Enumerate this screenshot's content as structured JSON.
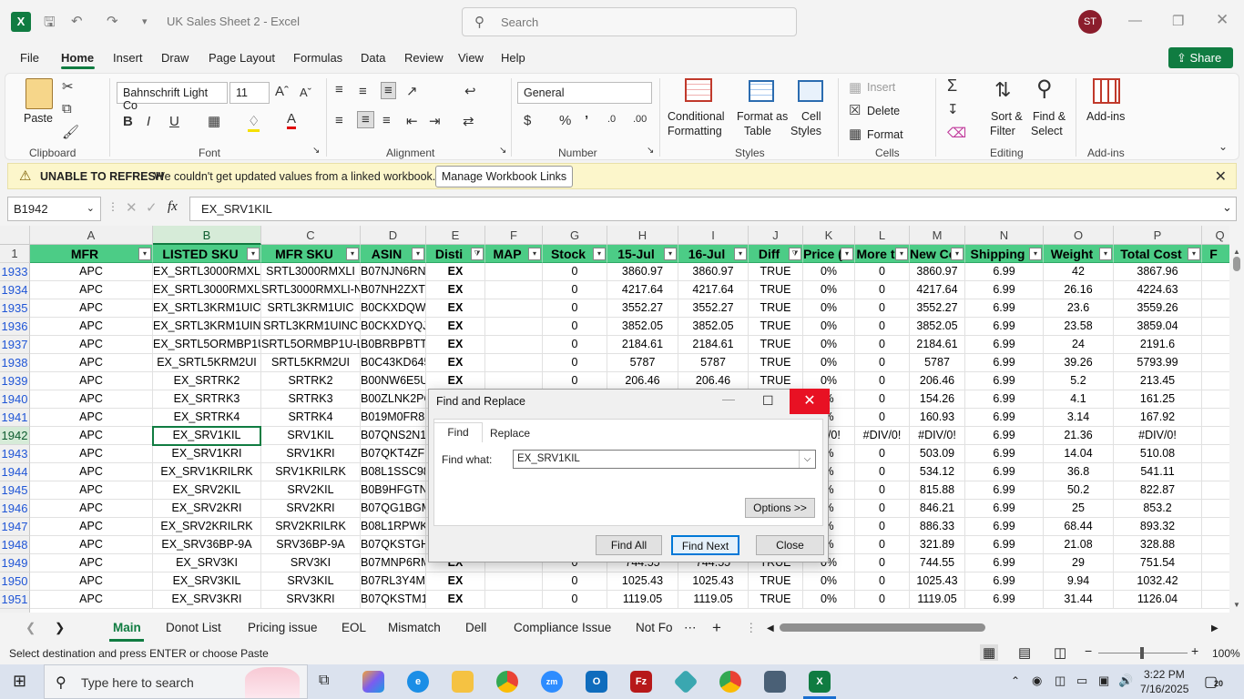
{
  "app": {
    "title": "UK Sales Sheet 2  -  Excel",
    "search_placeholder": "Search",
    "user_initials": "ST"
  },
  "menu": {
    "tabs": [
      "File",
      "Home",
      "Insert",
      "Draw",
      "Page Layout",
      "Formulas",
      "Data",
      "Review",
      "View",
      "Help"
    ],
    "active": "Home",
    "share_label": "Share"
  },
  "ribbon": {
    "clipboard": {
      "paste": "Paste",
      "label": "Clipboard"
    },
    "font": {
      "name": "Bahnschrift Light Co",
      "size": "11",
      "label": "Font"
    },
    "alignment": {
      "label": "Alignment"
    },
    "number": {
      "format": "General",
      "label": "Number"
    },
    "styles": {
      "conditional": "Conditional",
      "conditional2": "Formatting",
      "format_as": "Format as",
      "format_as2": "Table",
      "cell": "Cell",
      "cell2": "Styles",
      "label": "Styles"
    },
    "cells": {
      "insert": "Insert",
      "delete": "Delete",
      "format": "Format",
      "label": "Cells"
    },
    "editing": {
      "sort": "Sort &",
      "sort2": "Filter",
      "find": "Find &",
      "find2": "Select",
      "label": "Editing"
    },
    "addins": {
      "btn": "Add-ins",
      "label": "Add-ins"
    }
  },
  "warning": {
    "title": "UNABLE TO REFRESH",
    "message": "We couldn't get updated values from a linked workbook.",
    "button": "Manage Workbook Links"
  },
  "formula_bar": {
    "name_box": "B1942",
    "fx": "fx",
    "content": "EX_SRV1KIL"
  },
  "sheet": {
    "col_letters": [
      "A",
      "B",
      "C",
      "D",
      "E",
      "F",
      "G",
      "H",
      "I",
      "J",
      "K",
      "L",
      "M",
      "N",
      "O",
      "P",
      "Q"
    ],
    "header_row_number": "1",
    "headers": [
      "MFR",
      "LISTED SKU",
      "MFR SKU",
      "ASIN",
      "Disti",
      "MAP",
      "Stock",
      "15-Jul",
      "16-Jul",
      "Diff",
      "Price (",
      "More t",
      "New Co",
      "Shipping",
      "Weight",
      "Total Cost",
      "F"
    ],
    "rows": [
      {
        "n": "1933",
        "c": [
          "APC",
          "EX_SRTL3000RMXLI",
          "SRTL3000RMXLI",
          "B07NJN6RNX",
          "EX",
          "",
          "0",
          "3860.97",
          "3860.97",
          "TRUE",
          "0%",
          "0",
          "3860.97",
          "6.99",
          "42",
          "3867.96"
        ]
      },
      {
        "n": "1934",
        "c": [
          "APC",
          "EX_SRTL3000RMXLI-NC",
          "SRTL3000RMXLI-NC",
          "B07NH2ZXTG",
          "EX",
          "",
          "0",
          "4217.64",
          "4217.64",
          "TRUE",
          "0%",
          "0",
          "4217.64",
          "6.99",
          "26.16",
          "4224.63"
        ]
      },
      {
        "n": "1935",
        "c": [
          "APC",
          "EX_SRTL3KRM1UIC",
          "SRTL3KRM1UIC",
          "B0CKXDQW6N",
          "EX",
          "",
          "0",
          "3552.27",
          "3552.27",
          "TRUE",
          "0%",
          "0",
          "3552.27",
          "6.99",
          "23.6",
          "3559.26"
        ]
      },
      {
        "n": "1936",
        "c": [
          "APC",
          "EX_SRTL3KRM1UINC",
          "SRTL3KRM1UINC",
          "B0CKXDYQJ8",
          "EX",
          "",
          "0",
          "3852.05",
          "3852.05",
          "TRUE",
          "0%",
          "0",
          "3852.05",
          "6.99",
          "23.58",
          "3859.04"
        ]
      },
      {
        "n": "1937",
        "c": [
          "APC",
          "EX_SRTL5ORMBP1U-LI",
          "SRTL5ORMBP1U-LI",
          "B0BRBPBTTJ",
          "EX",
          "",
          "0",
          "2184.61",
          "2184.61",
          "TRUE",
          "0%",
          "0",
          "2184.61",
          "6.99",
          "24",
          "2191.6"
        ]
      },
      {
        "n": "1938",
        "c": [
          "APC",
          "EX_SRTL5KRM2UI",
          "SRTL5KRM2UI",
          "B0C43KD645",
          "EX",
          "",
          "0",
          "5787",
          "5787",
          "TRUE",
          "0%",
          "0",
          "5787",
          "6.99",
          "39.26",
          "5793.99"
        ]
      },
      {
        "n": "1939",
        "c": [
          "APC",
          "EX_SRTRK2",
          "SRTRK2",
          "B00NW6E5UO",
          "EX",
          "",
          "0",
          "206.46",
          "206.46",
          "TRUE",
          "0%",
          "0",
          "206.46",
          "6.99",
          "5.2",
          "213.45"
        ]
      },
      {
        "n": "1940",
        "c": [
          "APC",
          "EX_SRTRK3",
          "SRTRK3",
          "B00ZLNK2PO",
          "",
          "",
          "",
          "",
          "",
          "",
          "%",
          "0",
          "154.26",
          "6.99",
          "4.1",
          "161.25"
        ]
      },
      {
        "n": "1941",
        "c": [
          "APC",
          "EX_SRTRK4",
          "SRTRK4",
          "B019M0FR8S",
          "",
          "",
          "",
          "",
          "",
          "",
          "%",
          "0",
          "160.93",
          "6.99",
          "3.14",
          "167.92"
        ]
      },
      {
        "n": "1942",
        "c": [
          "APC",
          "EX_SRV1KIL",
          "SRV1KIL",
          "B07QNS2N17",
          "",
          "",
          "",
          "",
          "",
          "",
          "IV/0!",
          "#DIV/0!",
          "#DIV/0!",
          "6.99",
          "21.36",
          "#DIV/0!"
        ]
      },
      {
        "n": "1943",
        "c": [
          "APC",
          "EX_SRV1KRI",
          "SRV1KRI",
          "B07QKT4ZFB",
          "",
          "",
          "",
          "",
          "",
          "",
          "%",
          "0",
          "503.09",
          "6.99",
          "14.04",
          "510.08"
        ]
      },
      {
        "n": "1944",
        "c": [
          "APC",
          "EX_SRV1KRILRK",
          "SRV1KRILRK",
          "B08L1SSC98",
          "",
          "",
          "",
          "",
          "",
          "",
          "%",
          "0",
          "534.12",
          "6.99",
          "36.8",
          "541.11"
        ]
      },
      {
        "n": "1945",
        "c": [
          "APC",
          "EX_SRV2KIL",
          "SRV2KIL",
          "B0B9HFGTN9",
          "",
          "",
          "",
          "",
          "",
          "",
          "%",
          "0",
          "815.88",
          "6.99",
          "50.2",
          "822.87"
        ]
      },
      {
        "n": "1946",
        "c": [
          "APC",
          "EX_SRV2KRI",
          "SRV2KRI",
          "B07QG1BGMH",
          "",
          "",
          "",
          "",
          "",
          "",
          "%",
          "0",
          "846.21",
          "6.99",
          "25",
          "853.2"
        ]
      },
      {
        "n": "1947",
        "c": [
          "APC",
          "EX_SRV2KRILRK",
          "SRV2KRILRK",
          "B08L1RPWKB",
          "",
          "",
          "",
          "",
          "",
          "",
          "%",
          "0",
          "886.33",
          "6.99",
          "68.44",
          "893.32"
        ]
      },
      {
        "n": "1948",
        "c": [
          "APC",
          "EX_SRV36BP-9A",
          "SRV36BP-9A",
          "B07QKSTGHG",
          "",
          "",
          "",
          "",
          "",
          "",
          "%",
          "0",
          "321.89",
          "6.99",
          "21.08",
          "328.88"
        ]
      },
      {
        "n": "1949",
        "c": [
          "APC",
          "EX_SRV3KI",
          "SRV3KI",
          "B07MNP6RM9",
          "EX",
          "",
          "0",
          "744.55",
          "744.55",
          "TRUE",
          "0%",
          "0",
          "744.55",
          "6.99",
          "29",
          "751.54"
        ]
      },
      {
        "n": "1950",
        "c": [
          "APC",
          "EX_SRV3KIL",
          "SRV3KIL",
          "B07RL3Y4MP",
          "EX",
          "",
          "0",
          "1025.43",
          "1025.43",
          "TRUE",
          "0%",
          "0",
          "1025.43",
          "6.99",
          "9.94",
          "1032.42"
        ]
      },
      {
        "n": "1951",
        "c": [
          "APC",
          "EX_SRV3KRI",
          "SRV3KRI",
          "B07QKSTM12",
          "EX",
          "",
          "0",
          "1119.05",
          "1119.05",
          "TRUE",
          "0%",
          "0",
          "1119.05",
          "6.99",
          "31.44",
          "1126.04"
        ]
      }
    ]
  },
  "sheet_tabs": {
    "tabs": [
      "Main",
      "Donot List",
      "Pricing issue",
      "EOL",
      "Mismatch",
      "Dell",
      "Compliance Issue",
      "Not Fo"
    ],
    "active": "Main"
  },
  "status": {
    "message": "Select destination and press ENTER or choose Paste",
    "zoom": "100%"
  },
  "dialog": {
    "title": "Find and Replace",
    "tab_find": "Find",
    "tab_replace": "Replace",
    "find_label": "Find what:",
    "find_value": "EX_SRV1KIL",
    "options": "Options >>",
    "find_all": "Find All",
    "find_next": "Find Next",
    "close": "Close"
  },
  "taskbar": {
    "search_placeholder": "Type here to search",
    "time": "3:22 PM",
    "date": "7/16/2025",
    "notif_count": "20"
  }
}
